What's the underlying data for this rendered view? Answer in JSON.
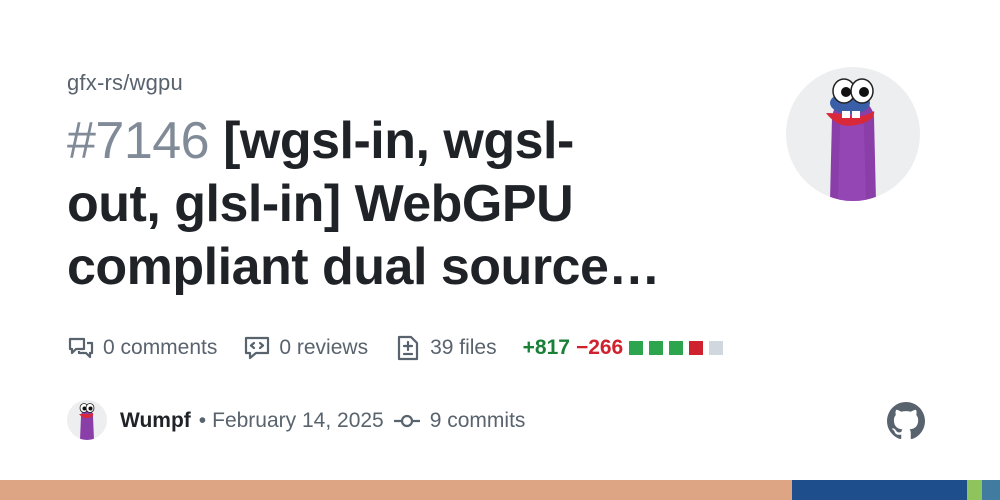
{
  "repo": "gfx-rs/wgpu",
  "pr": {
    "number": "#7146",
    "title_lines": [
      "[wgsl-in, wgsl-",
      "out, glsl-in] WebGPU",
      "compliant dual source…"
    ]
  },
  "stats": {
    "comments": "0 comments",
    "reviews": "0 reviews",
    "files": "39 files",
    "additions": "+817",
    "deletions": "−266",
    "diff_blocks": [
      "#2da44e",
      "#2da44e",
      "#2da44e",
      "#cf222e",
      "#d0d7de"
    ]
  },
  "meta": {
    "author": "Wumpf",
    "separator": "•",
    "date": "February 14, 2025",
    "commits": "9 commits"
  },
  "icons": {
    "comments": "comment-discussion-icon",
    "reviews": "code-review-icon",
    "files": "file-diff-icon",
    "commits": "git-commit-icon",
    "github": "github-mark-icon"
  },
  "language_bar": [
    {
      "color": "#dea584",
      "share": 0.792
    },
    {
      "color": "#1e4f8c",
      "share": 0.175
    },
    {
      "color": "#8fc35c",
      "share": 0.015
    },
    {
      "color": "#427ba0",
      "share": 0.018
    }
  ]
}
